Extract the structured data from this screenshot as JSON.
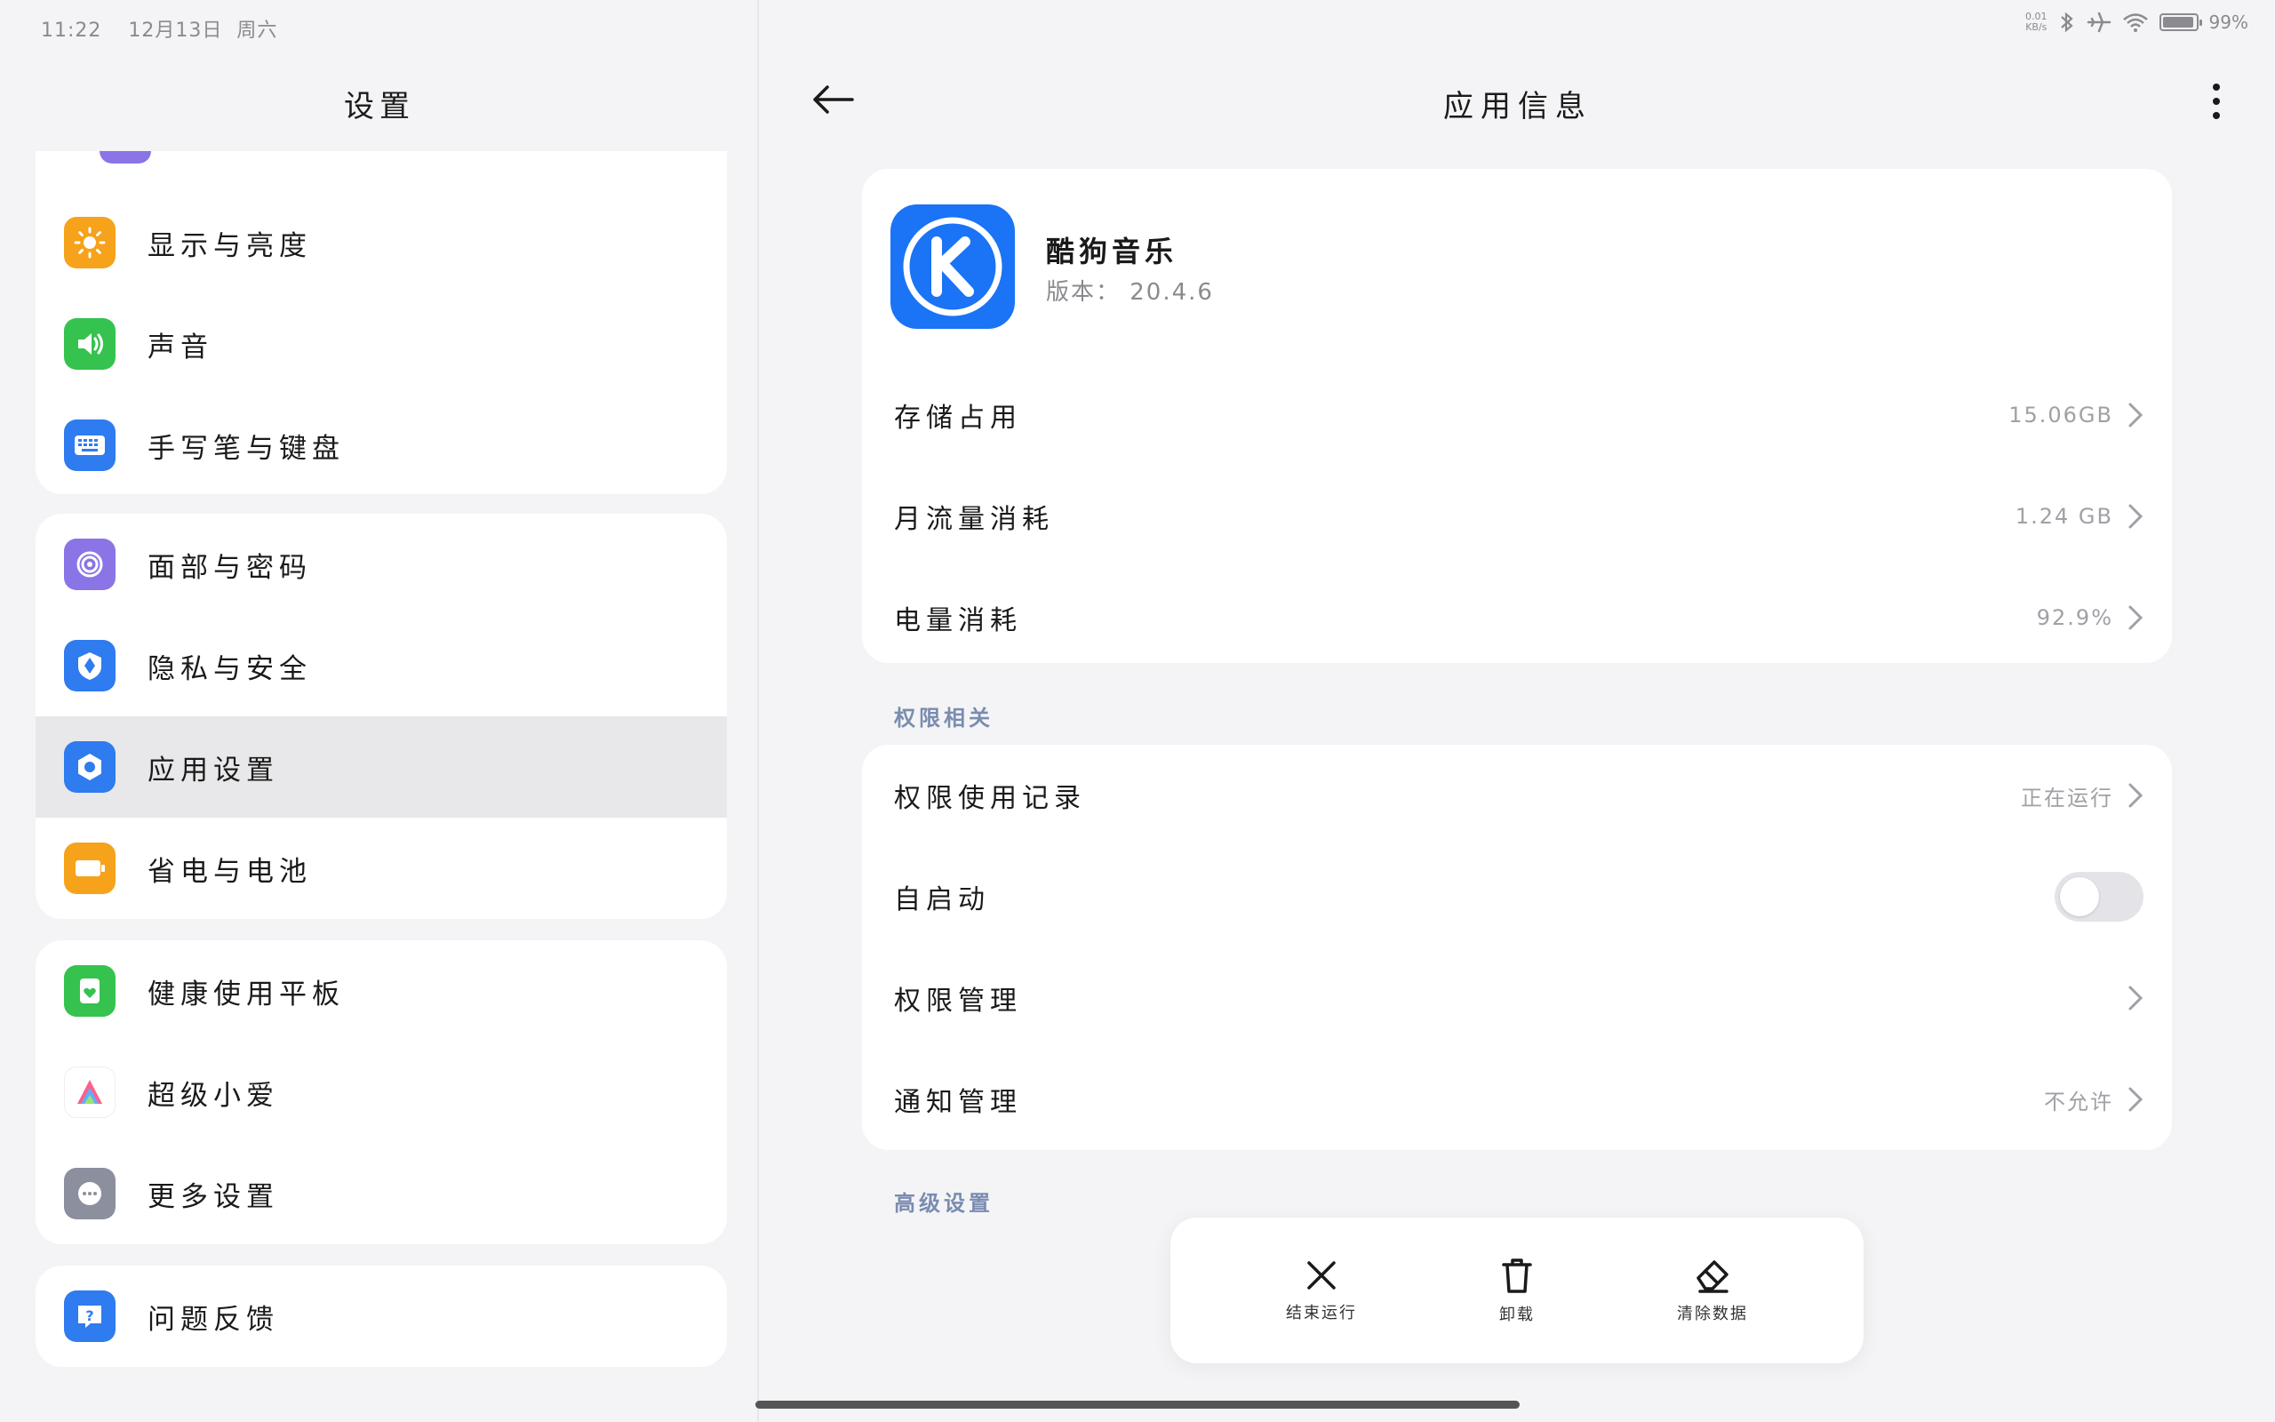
{
  "status_bar": {
    "time": "11:22",
    "date": "12月13日",
    "weekday": "周六",
    "net_speed_value": "0.01",
    "net_speed_unit": "KB/s",
    "battery": "99%"
  },
  "left": {
    "title": "设置",
    "groups": [
      [
        {
          "label": "显示与亮度",
          "icon": "sun-icon",
          "color": "#f6a21b"
        },
        {
          "label": "声音",
          "icon": "speaker-icon",
          "color": "#36c24f"
        },
        {
          "label": "手写笔与键盘",
          "icon": "keyboard-icon",
          "color": "#2f7bf0"
        }
      ],
      [
        {
          "label": "面部与密码",
          "icon": "face-id-icon",
          "color": "#8a74e6"
        },
        {
          "label": "隐私与安全",
          "icon": "shield-icon",
          "color": "#2f7bf0"
        },
        {
          "label": "应用设置",
          "icon": "app-settings-icon",
          "color": "#2f7bf0"
        },
        {
          "label": "省电与电池",
          "icon": "battery-icon",
          "color": "#f6a21b"
        }
      ],
      [
        {
          "label": "健康使用平板",
          "icon": "health-icon",
          "color": "#36c24f"
        },
        {
          "label": "超级小爱",
          "icon": "xiaoai-icon",
          "color": "#ffffff"
        },
        {
          "label": "更多设置",
          "icon": "more-dots-icon",
          "color": "#8c8f9e"
        }
      ],
      [
        {
          "label": "问题反馈",
          "icon": "feedback-icon",
          "color": "#2f7bf0"
        }
      ]
    ],
    "active_item": "应用设置"
  },
  "right": {
    "title": "应用信息",
    "app": {
      "name": "酷狗音乐",
      "version": "版本： 20.4.6",
      "icon_color": "#1b73f6"
    },
    "usage_rows": [
      {
        "label": "存储占用",
        "value": "15.06GB"
      },
      {
        "label": "月流量消耗",
        "value": "1.24 GB"
      },
      {
        "label": "电量消耗",
        "value": "92.9%"
      }
    ],
    "permissions_title": "权限相关",
    "permission_rows": [
      {
        "label": "权限使用记录",
        "value": "正在运行",
        "type": "link"
      },
      {
        "label": "自启动",
        "value": "",
        "type": "toggle",
        "on": false
      },
      {
        "label": "权限管理",
        "value": "",
        "type": "link"
      },
      {
        "label": "通知管理",
        "value": "不允许",
        "type": "link"
      }
    ],
    "advanced_title": "高级设置",
    "actions": [
      {
        "label": "结束运行",
        "icon": "close-icon"
      },
      {
        "label": "卸载",
        "icon": "trash-icon"
      },
      {
        "label": "清除数据",
        "icon": "eraser-icon"
      }
    ]
  }
}
